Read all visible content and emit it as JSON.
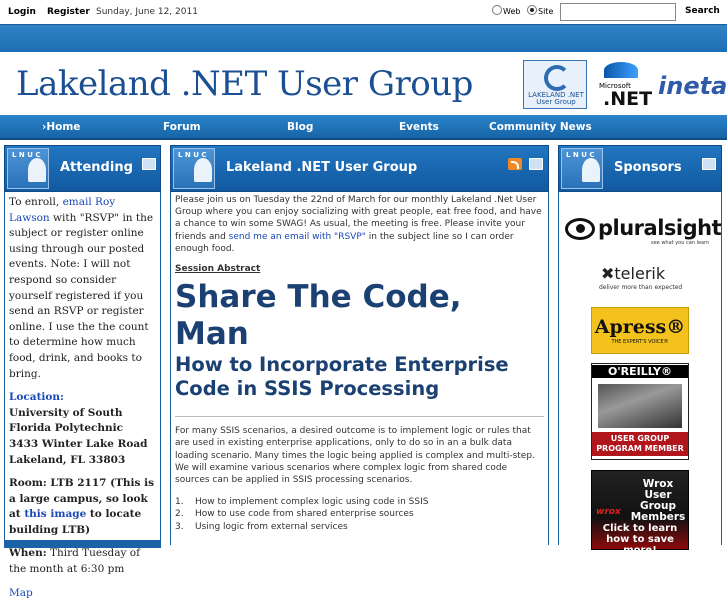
{
  "topbar": {
    "login": "Login",
    "register": "Register",
    "date": "Sunday, June 12, 2011",
    "radio_web": "Web",
    "radio_site": "Site",
    "search_value": "",
    "search_button": "Search"
  },
  "header": {
    "site_title": "Lakeland .NET User Group",
    "logo_lnug": "LAKELAND .NET User Group",
    "logo_ms_small": "Microsoft",
    "logo_ms_big": ".NET",
    "logo_ineta": "ineta"
  },
  "nav": {
    "items": [
      "Home",
      "Forum",
      "Blog",
      "Events",
      "Community News"
    ]
  },
  "attending": {
    "title": "Attending",
    "badge": "L N U C",
    "p1_pre": "To enroll, ",
    "p1_link": "email Roy Lawson",
    "p1_post": " with \"RSVP\" in the subject or register online using through our posted events.  Note: I will not respond so consider yourself registered if you send an RSVP or register online.  I use the the count to determine how much food, drink, and books to bring.",
    "location_label": "Location:",
    "location_line1": "University of South Florida Polytechnic",
    "location_line2": "3433 Winter Lake Road",
    "location_line3": "Lakeland, FL 33803",
    "room_pre": "Room: LTB 2117 (This is a large campus, so look at ",
    "room_link": "this image",
    "room_post": " to locate building LTB)",
    "when_label": "When:",
    "when_text": " Third Tuesday of the month at 6:30 pm",
    "map_link": "Map"
  },
  "main": {
    "title": "Lakeland .NET User Group",
    "intro_pre": "Please join us on Tuesday the 22nd of March for our monthly Lakeland .Net User Group where you can enjoy socializing with great people, eat free food, and have a chance to win some SWAG! As usual, the meeting is free. Please invite your friends and ",
    "intro_link": "send me an email with \"RSVP\"",
    "intro_post": " in the subject line so I can order enough food.",
    "abstract_heading": "Session Abstract",
    "headline": "Share The Code, Man",
    "subheadline": "How to Incorporate Enterprise Code in SSIS Processing",
    "body": "For many SSIS scenarios, a desired outcome is to implement logic or rules that are used in existing enterprise applications, only to do so in an a bulk data loading scenario.  Many times the logic being applied is complex and multi-step.  We will examine various scenarios where complex logic from shared code sources can be applied in SSIS processing scenarios.",
    "list": [
      {
        "n": "1.",
        "text": "How to implement complex logic using code in SSIS"
      },
      {
        "n": "2.",
        "text": "How to use code from shared enterprise sources"
      },
      {
        "n": "3.",
        "text": "Using logic from external services"
      }
    ]
  },
  "sponsors": {
    "title": "Sponsors",
    "pluralsight": "pluralsight",
    "pluralsight_tag": "see what you can learn",
    "telerik": "✖telerik",
    "telerik_tag": "deliver more than expected",
    "apress": "Apress®",
    "apress_tag": "THE EXPERT'S VOICE®",
    "oreilly": "O'REILLY®",
    "oreilly_badge": "USER GROUP PROGRAM MEMBER",
    "wrox_title": "Wrox User Group Members",
    "wrox_logo": "wrox",
    "wrox_cta": "Click to learn how to save more!"
  },
  "colors": {
    "brand_blue": "#1b63a8",
    "title_blue": "#1b4f93",
    "link_blue": "#1a49b7"
  }
}
